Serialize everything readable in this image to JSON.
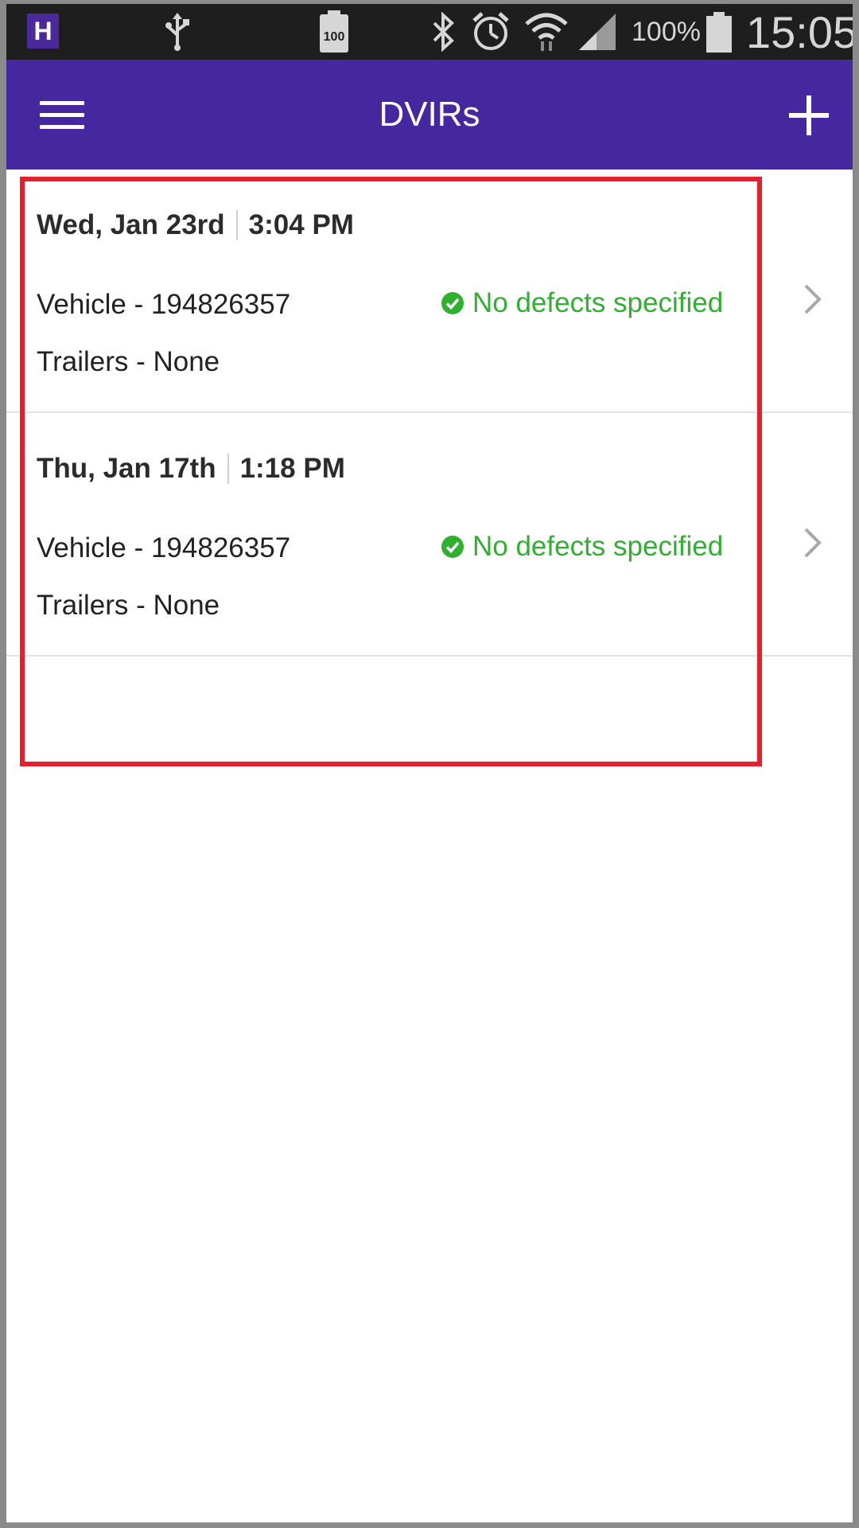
{
  "status_bar": {
    "app_badge": "H",
    "battery_small_label": "100",
    "battery_percent": "100%",
    "clock": "15:05",
    "icons": [
      "usb-icon",
      "battery-100-icon",
      "bluetooth-icon",
      "alarm-icon",
      "wifi-icon",
      "signal-icon",
      "battery-icon"
    ]
  },
  "app_bar": {
    "title": "DVIRs",
    "background_color": "#4527a0"
  },
  "dvirs": [
    {
      "date": "Wed, Jan 23rd",
      "time": "3:04 PM",
      "vehicle": "Vehicle - 194826357",
      "trailers": "Trailers - None",
      "status": "No defects specified"
    },
    {
      "date": "Thu, Jan 17th",
      "time": "1:18 PM",
      "vehicle": "Vehicle - 194826357",
      "trailers": "Trailers - None",
      "status": "No defects specified"
    }
  ],
  "colors": {
    "status_ok": "#2fb02f",
    "highlight": "#e51f2e"
  }
}
